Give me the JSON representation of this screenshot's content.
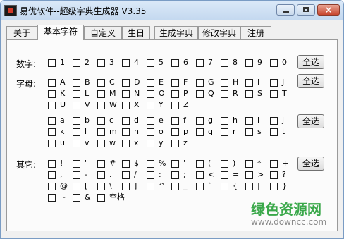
{
  "window": {
    "title": "易优软件--超级字典生成器 V3.35",
    "close_glyph": "×"
  },
  "tabs": [
    "关于",
    "基本字符",
    "自定义",
    "生日",
    "生成字典",
    "修改字典",
    "注册"
  ],
  "active_tab": 1,
  "groups": [
    {
      "label": "数字:",
      "select_all_label": "全选",
      "rows": [
        [
          "1",
          "2",
          "3",
          "4",
          "5",
          "6",
          "7",
          "8",
          "9",
          "0"
        ]
      ]
    },
    {
      "label": "字母:",
      "select_all_label": "全选",
      "rows": [
        [
          "A",
          "B",
          "C",
          "D",
          "E",
          "F",
          "G",
          "H",
          "I",
          "J"
        ],
        [
          "K",
          "L",
          "M",
          "N",
          "O",
          "P",
          "Q",
          "R",
          "S",
          "T"
        ],
        [
          "U",
          "V",
          "W",
          "X",
          "Y",
          "Z"
        ]
      ]
    },
    {
      "label": "",
      "select_all_label": "全选",
      "rows": [
        [
          "a",
          "b",
          "c",
          "d",
          "e",
          "f",
          "g",
          "h",
          "i",
          "j"
        ],
        [
          "k",
          "l",
          "m",
          "n",
          "o",
          "p",
          "q",
          "r",
          "s",
          "t"
        ],
        [
          "u",
          "v",
          "w",
          "x",
          "y",
          "z"
        ]
      ]
    },
    {
      "label": "其它:",
      "select_all_label": "全选",
      "rows": [
        [
          "!",
          "\"",
          "#",
          "$",
          "%",
          "'",
          "(",
          ")",
          "*",
          "+"
        ],
        [
          ",",
          "-",
          ".",
          "/",
          ":",
          ";",
          "<",
          "=",
          ">",
          "?"
        ],
        [
          "@",
          "[",
          "\\",
          "]",
          "^",
          "_",
          "`",
          "{",
          "|",
          "}"
        ],
        [
          "~",
          "&",
          "空格"
        ]
      ]
    }
  ],
  "watermark": {
    "name": "绿色资源网",
    "url": "www.downcc.com"
  }
}
